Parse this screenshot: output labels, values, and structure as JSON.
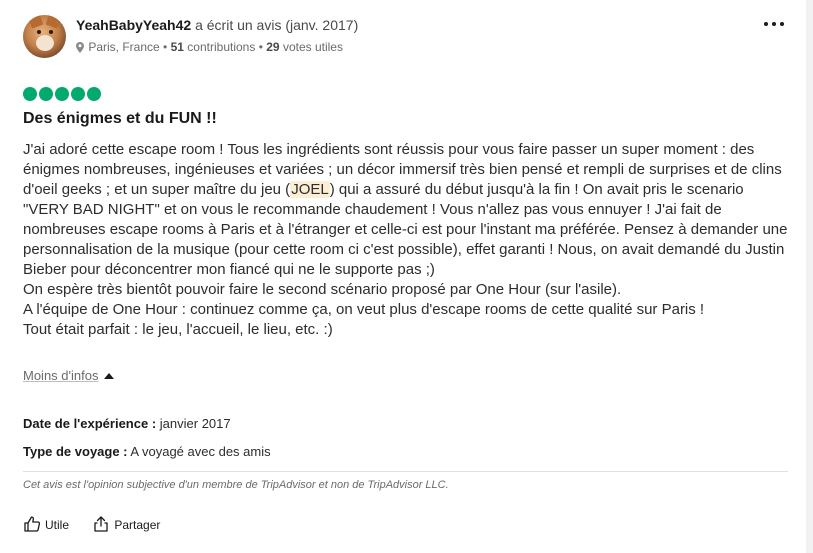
{
  "review": {
    "author": "YeahBabyYeah42",
    "wrote_text": "a écrit un avis (janv. 2017)",
    "location": "Paris, France",
    "contrib_count": "51",
    "contrib_label": "contributions",
    "separator": "•",
    "votes_count": "29",
    "votes_label": "votes utiles",
    "rating": 5,
    "title": "Des énigmes et du FUN !!",
    "body": {
      "p1_before": "J'ai adoré cette escape room ! Tous les ingrédients sont réussis pour vous faire passer un super moment : des énigmes nombreuses, ingénieuses et variées ; un décor immersif très bien pensé et rempli de surprises et de clins d'oeil geeks ; et un super maître du jeu (",
      "p1_highlight": "JOEL",
      "p1_after": ") qui a assuré du début jusqu'à la fin ! On avait pris le scenario \"VERY BAD NIGHT\" et on vous le recommande chaudement ! Vous n'allez pas vous ennuyer ! J'ai fait de nombreuses escape rooms à Paris et à l'étranger et celle-ci est pour l'instant ma préférée. Pensez à demander une personnalisation de la musique (pour cette room ci c'est possible), effet garanti ! Nous, on avait demandé du Justin Bieber pour déconcentrer mon fiancé qui ne le supporte pas ;)",
      "p2": "On espère très bientôt pouvoir faire le second scénario proposé par One Hour (sur l'asile).",
      "p3": "A l'équipe de One Hour : continuez comme ça, on veut plus d'escape rooms de cette qualité sur Paris !",
      "p4": "Tout était parfait : le jeu, l'accueil, le lieu, etc. :)"
    },
    "less_info": "Moins d'infos",
    "experience_date_label": "Date de l'expérience :",
    "experience_date_value": "janvier 2017",
    "trip_type_label": "Type de voyage :",
    "trip_type_value": "A voyagé avec des amis",
    "disclaimer": "Cet avis est l'opinion subjective d'un membre de TripAdvisor et non de TripAdvisor LLC."
  },
  "actions": {
    "helpful": "Utile",
    "share": "Partager"
  },
  "colors": {
    "rating_bubble": "#00aa6c",
    "highlight": "#fbeed4"
  },
  "icons": [
    "more-icon",
    "pin-icon",
    "thumbs-up-icon",
    "share-icon",
    "chevron-up-icon"
  ]
}
